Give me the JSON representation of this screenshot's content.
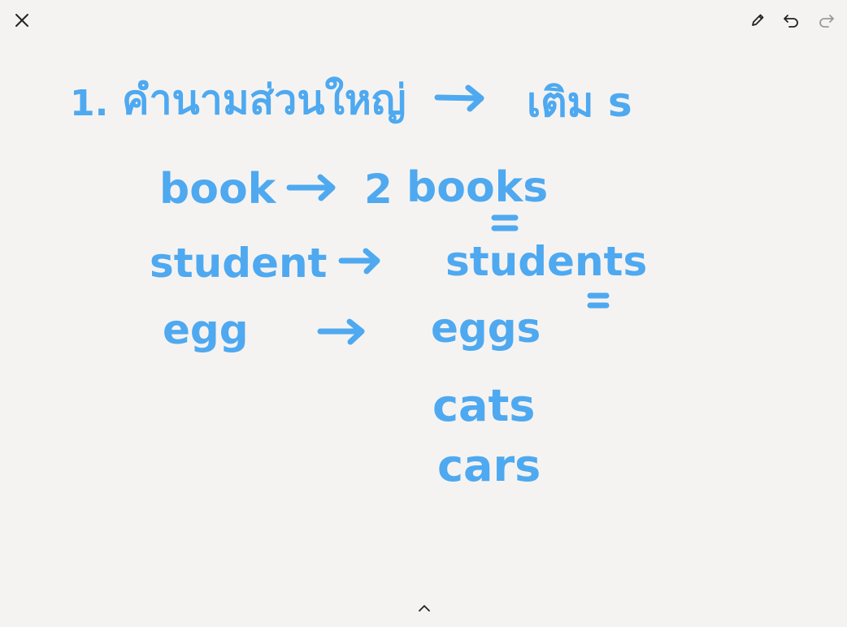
{
  "toolbar": {
    "close_icon": "close-icon",
    "pen_icon": "pencil-icon",
    "undo_icon": "undo-icon",
    "redo_icon": "redo-icon",
    "redo_enabled": false
  },
  "bottom": {
    "expand_icon": "chevron-up-icon"
  },
  "colors": {
    "background": "#f5f3f1",
    "ink": "#4ea9f0",
    "toolbar_icon": "#222222",
    "disabled_icon": "#9a9a9a"
  },
  "note": {
    "heading": {
      "number": "1.",
      "text": "คำนามส่วนใหญ่",
      "result": "เติม s"
    },
    "rows": [
      {
        "singular": "book",
        "count": "2",
        "plural": "books"
      },
      {
        "singular": "student",
        "plural": "students"
      },
      {
        "singular": "egg",
        "plural": "eggs"
      }
    ],
    "extra_plurals": [
      "cats",
      "cars"
    ]
  }
}
